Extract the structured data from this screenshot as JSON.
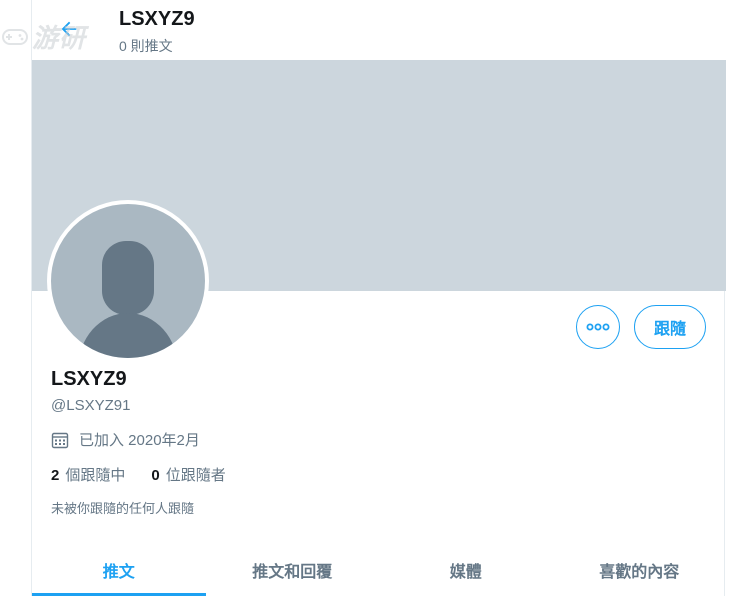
{
  "header": {
    "title": "LSXYZ9",
    "subtitle": "0 則推文"
  },
  "watermark": {
    "text": "游研"
  },
  "profile": {
    "display_name": "LSXYZ9",
    "handle": "@LSXYZ91",
    "joined": "已加入 2020年2月",
    "following_count": "2",
    "following_label": "個跟隨中",
    "followers_count": "0",
    "followers_label": "位跟隨者",
    "note": "未被你跟隨的任何人跟隨"
  },
  "actions": {
    "more_icon": "more-horizontal-icon",
    "follow_label": "跟隨"
  },
  "tabs": [
    {
      "label": "推文",
      "active": true
    },
    {
      "label": "推文和回覆",
      "active": false
    },
    {
      "label": "媒體",
      "active": false
    },
    {
      "label": "喜歡的內容",
      "active": false
    }
  ],
  "colors": {
    "accent": "#1da1f2",
    "banner": "#ccd6dd",
    "avatar_bg": "#aab8c2",
    "avatar_figure": "#657786",
    "secondary_text": "#657786"
  }
}
